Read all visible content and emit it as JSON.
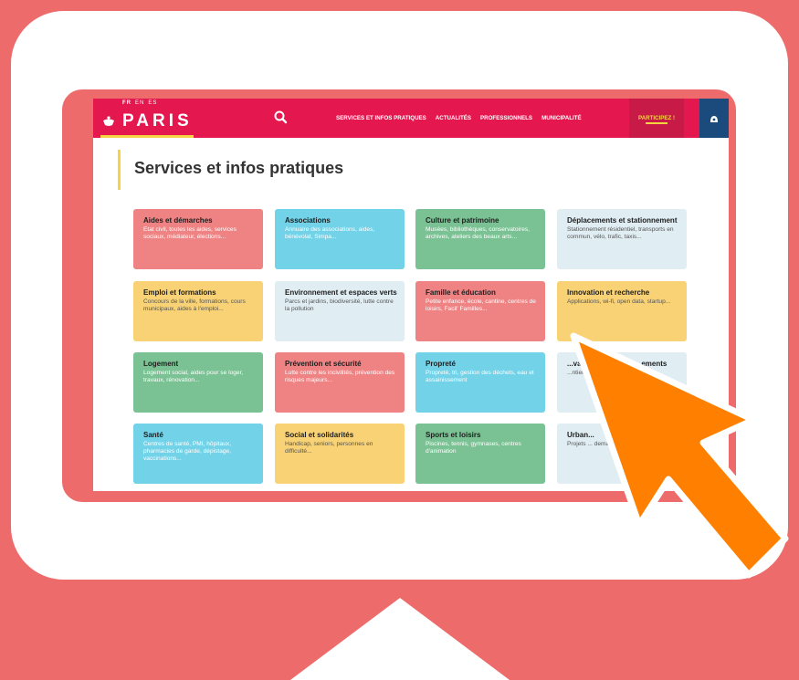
{
  "header": {
    "languages": [
      "FR",
      "EN",
      "ES"
    ],
    "logo_text": "PARIS",
    "nav_items": [
      "SERVICES ET INFOS PRATIQUES",
      "ACTUALITÉS",
      "PROFESSIONNELS",
      "MUNICIPALITÉ"
    ],
    "cta_label": "PARTICIPEZ !"
  },
  "page": {
    "title": "Services et infos pratiques"
  },
  "cards": [
    {
      "title": "Aides et démarches",
      "desc": "Etat civil, toutes les aides, services sociaux, médiateur, élections..."
    },
    {
      "title": "Associations",
      "desc": "Annuaire des associations, aides, bénévolat, Simpa..."
    },
    {
      "title": "Culture et patrimoine",
      "desc": "Musées, bibliothèques, conservatoires, archives, ateliers des beaux arts..."
    },
    {
      "title": "Déplacements et stationnement",
      "desc": "Stationnement résidentiel, transports en commun, vélo, trafic, taxis..."
    },
    {
      "title": "Emploi et formations",
      "desc": "Concours de la ville, formations, cours municipaux, aides à l'emploi..."
    },
    {
      "title": "Environnement et espaces verts",
      "desc": "Parcs et jardins, biodiversité, lutte contre la pollution"
    },
    {
      "title": "Famille et éducation",
      "desc": "Petite enfance, école, cantine, centres de loisirs, Facil' Familles..."
    },
    {
      "title": "Innovation et recherche",
      "desc": "Applications, wi-fi, open data, startup..."
    },
    {
      "title": "Logement",
      "desc": "Logement social, aides pour se loger, travaux, rénovation..."
    },
    {
      "title": "Prévention et sécurité",
      "desc": "Lutte contre les incivilités, prévention des risques majeurs..."
    },
    {
      "title": "Propreté",
      "desc": "Propreté, tri, gestion des déchets, eau et assainissement"
    },
    {
      "title": "...vation, travaux et ...ements",
      "desc": "...ntiers de ...ique..."
    },
    {
      "title": "Santé",
      "desc": "Centres de santé, PMI, hôpitaux, pharmacies de garde, dépistage, vaccinations..."
    },
    {
      "title": "Social et solidarités",
      "desc": "Handicap, seniors, personnes en difficulté..."
    },
    {
      "title": "Sports et loisirs",
      "desc": "Piscines, tennis, gymnases, centres d'animation"
    },
    {
      "title": "Urban...",
      "desc": "Projets ... demande..."
    }
  ],
  "colors": {
    "background": "#ee6b6b",
    "header": "#e5174f",
    "accent_yellow": "#f5d442",
    "account": "#1b4a7d",
    "card_red": "#ef8384",
    "card_blue": "#72d2e8",
    "card_green": "#7ac293",
    "card_yellow": "#f8d274",
    "card_pale": "#e0eef4",
    "cursor": "#ff8000"
  },
  "icons": {
    "logo": "ship-icon",
    "search": "search-icon",
    "account": "user-icon",
    "pointer": "cursor-arrow-icon"
  }
}
